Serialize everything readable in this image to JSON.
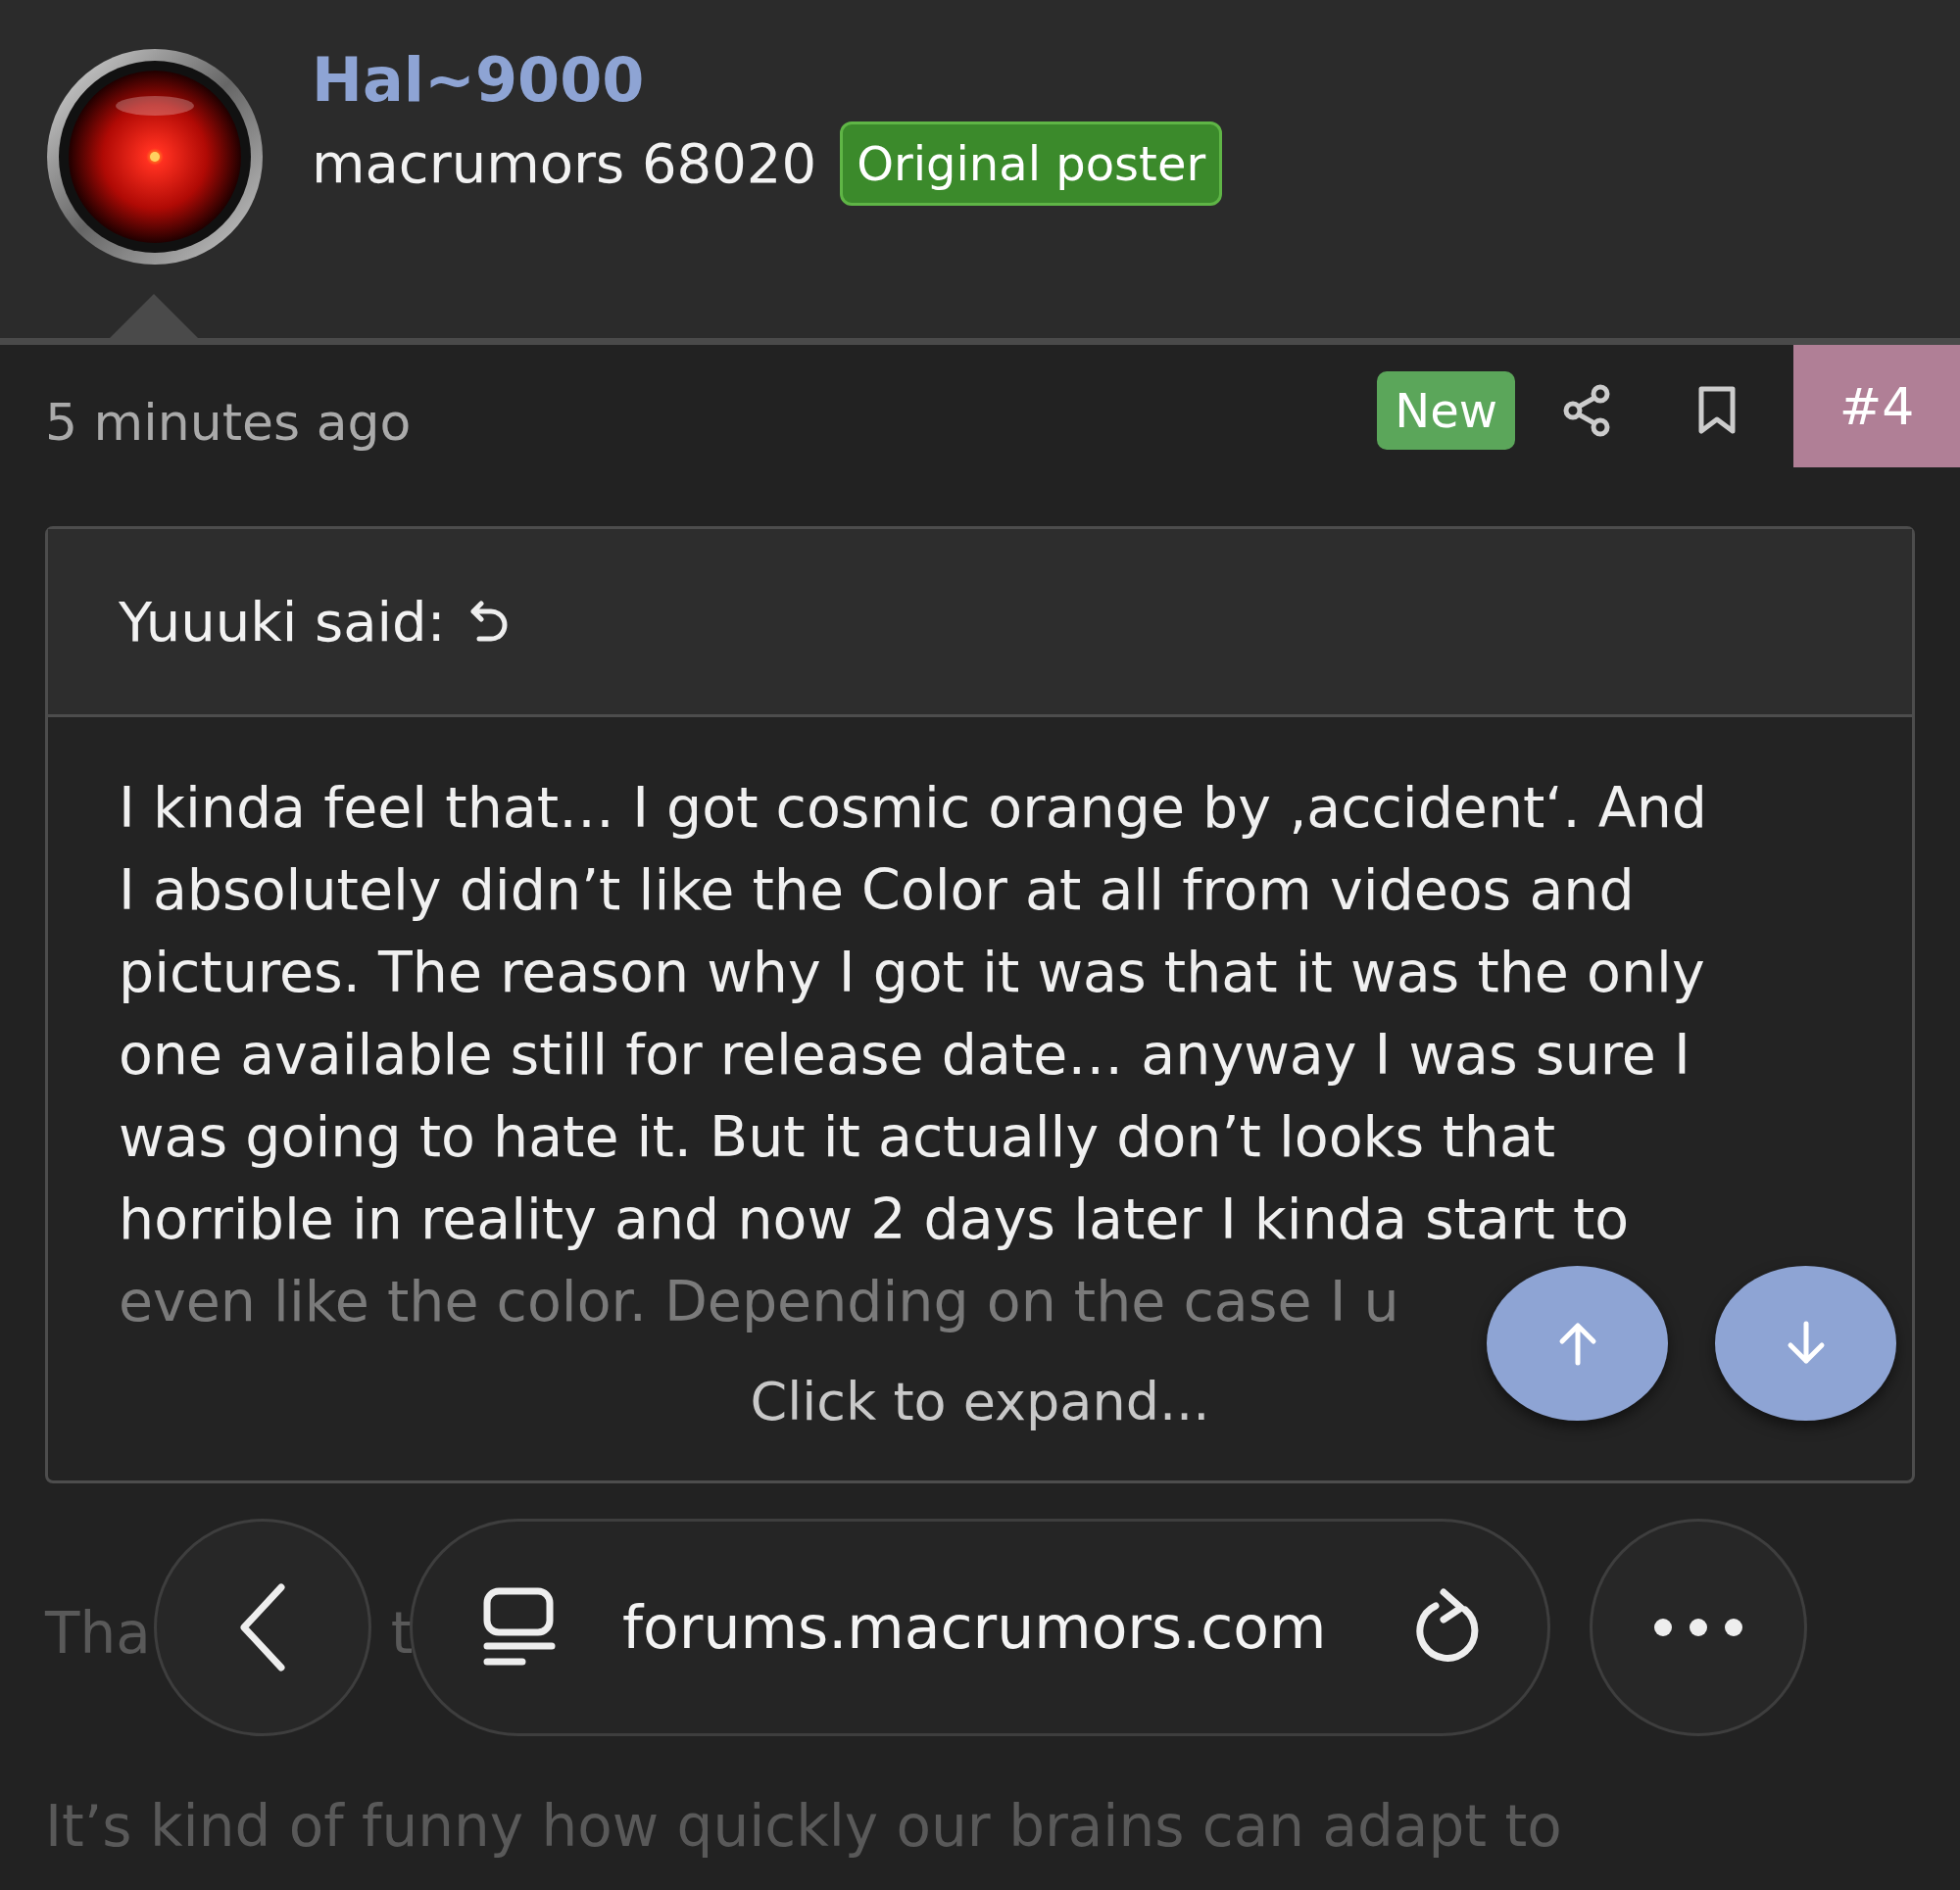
{
  "author": {
    "name": "Hal~9000",
    "rank": "macrumors 68020",
    "badge": "Original poster"
  },
  "post_bar": {
    "time": "5 minutes ago",
    "new_badge": "New",
    "post_number": "#4"
  },
  "quote": {
    "attribution": "Yuuuki said:",
    "lines": [
      {
        "text": "I kinda feel that… I got cosmic orange by ‚accident‘. And",
        "faded": false
      },
      {
        "text": "I absolutely didn’t like the Color at all from videos and",
        "faded": false
      },
      {
        "text": "pictures. The reason why I got it was that it was the only",
        "faded": false
      },
      {
        "text": "one available still for release date… anyway I was sure I",
        "faded": false
      },
      {
        "text": "was going to hate it. But it actually don’t looks that",
        "faded": false
      },
      {
        "text": "horrible in reality and now 2 days later I kinda start to",
        "faded": false
      },
      {
        "text": "even like the color. Depending on the case I u",
        "faded": true
      }
    ],
    "expand": "Click to expand..."
  },
  "reply_fragments": [
    "Tha",
    "t"
  ],
  "next_line": "It’s kind of funny how quickly our brains can adapt to",
  "browser_bar": {
    "url": "forums.macrumors.com"
  }
}
